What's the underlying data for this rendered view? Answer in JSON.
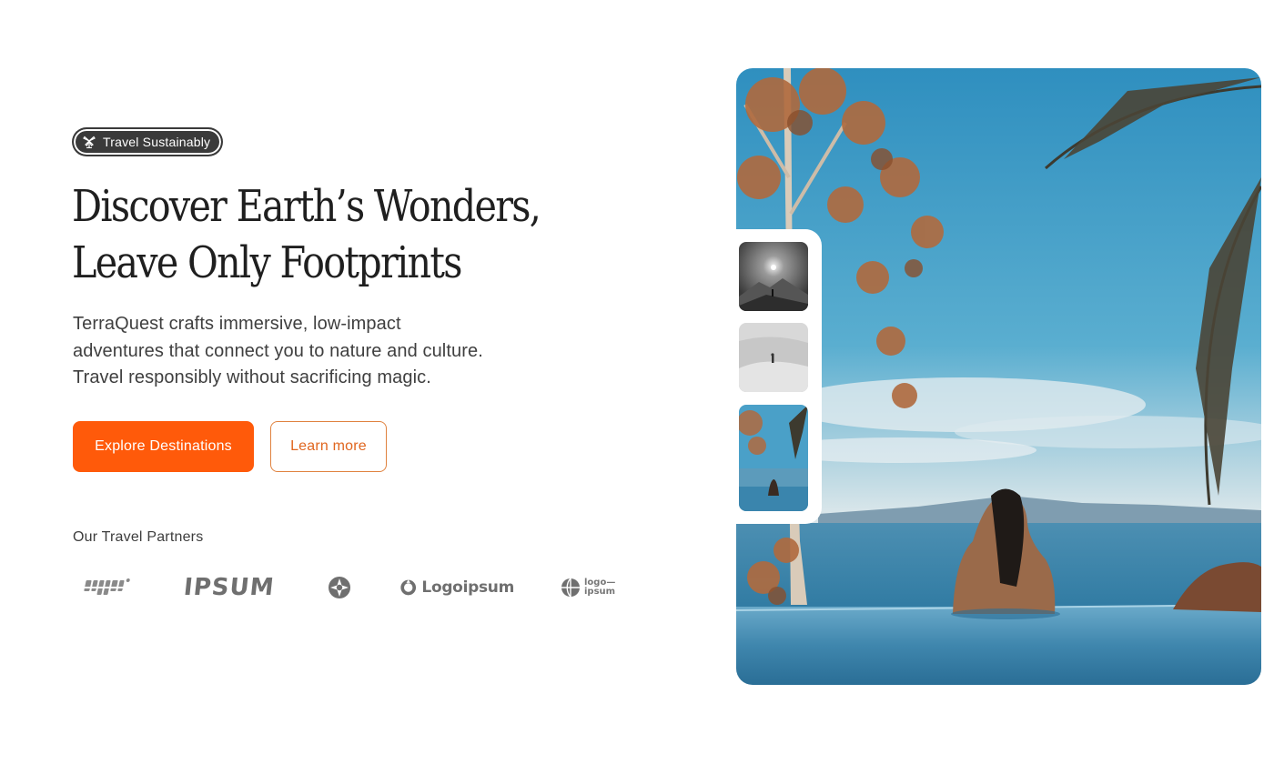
{
  "badge": {
    "label": "Travel Sustainably",
    "icon": "windmill-icon"
  },
  "hero": {
    "headline_lines": [
      "Discover Earth’s Wonders,",
      "Leave Only Footprints"
    ],
    "subtext_lines": [
      "TerraQuest crafts immersive, low-impact",
      "adventures that connect you to nature and culture.",
      "Travel responsibly without sacrificing magic."
    ]
  },
  "buttons": {
    "primary": "Explore Destinations",
    "secondary": "Learn more"
  },
  "partners": {
    "title": "Our Travel Partners",
    "logos": [
      {
        "name": "logo-1-icon",
        "text": ""
      },
      {
        "name": "ipsum-logo",
        "text": "IPSUM"
      },
      {
        "name": "star-circle-logo-icon",
        "text": ""
      },
      {
        "name": "logoipsum-logo",
        "text": "Logoipsum"
      },
      {
        "name": "logo-ipsum-small-logo",
        "text": "logo—\nipsum"
      }
    ]
  },
  "colors": {
    "accent": "#ff5a0a",
    "accent_outline": "#e0823f",
    "badge_bg": "#3a3a3a",
    "text_dark": "#1f1f1f"
  },
  "gallery": {
    "main_image": "infinity-pool-ocean-photo",
    "thumbnails": [
      "mountain-sunrise-bw-photo",
      "desert-dunes-bw-photo",
      "infinity-pool-thumbnail-photo"
    ]
  }
}
